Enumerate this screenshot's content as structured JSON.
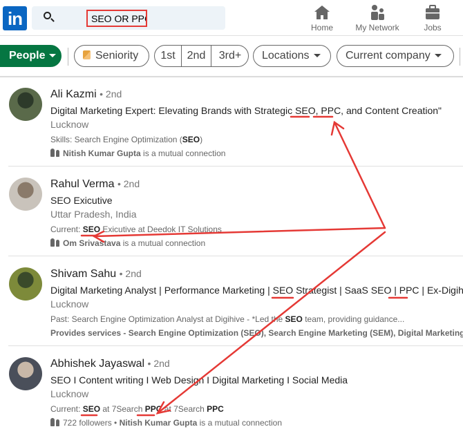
{
  "header": {
    "logo": "in",
    "search_value": "SEO OR PPC",
    "nav": [
      {
        "label": "Home",
        "icon": "home-icon"
      },
      {
        "label": "My Network",
        "icon": "people-icon"
      },
      {
        "label": "Jobs",
        "icon": "briefcase-icon"
      }
    ]
  },
  "filters": {
    "people": "People",
    "seniority": "Seniority",
    "first": "1st",
    "second": "2nd",
    "third": "3rd+",
    "locations": "Locations",
    "current_company": "Current company"
  },
  "results": [
    {
      "name": "Ali Kazmi",
      "degree": "• 2nd",
      "headline": "Digital Marketing Expert: Elevating Brands with Strategic SEO, PPC, and Content Creation\"",
      "location": "Lucknow",
      "snippet": [
        {
          "t": "Skills: Search Engine Optimization ("
        },
        {
          "t": "SEO",
          "b": true
        },
        {
          "t": ")"
        }
      ],
      "mutual": [
        {
          "t": "Nitish Kumar Gupta",
          "b": true
        },
        {
          "t": " is a mutual connection"
        }
      ]
    },
    {
      "name": "Rahul Verma",
      "degree": "• 2nd",
      "headline": "SEO Exicutive",
      "location": "Uttar Pradesh, India",
      "snippet": [
        {
          "t": "Current: "
        },
        {
          "t": "SEO",
          "b": true
        },
        {
          "t": " Exicutive at Deedok IT Solutions"
        }
      ],
      "mutual": [
        {
          "t": "Om Srivastava",
          "b": true
        },
        {
          "t": " is a mutual connection"
        }
      ]
    },
    {
      "name": "Shivam Sahu",
      "degree": "• 2nd",
      "headline": "Digital Marketing Analyst | Performance Marketing | SEO Strategist | SaaS SEO | PPC | Ex-Digihiv...",
      "location": "Lucknow",
      "snippet": [
        {
          "t": "Past: Search Engine Optimization Analyst at Digihive - *Led the "
        },
        {
          "t": "SEO",
          "b": true
        },
        {
          "t": " team, providing guidance..."
        }
      ],
      "mutual": [
        {
          "t": "Provides services - Search Engine Optimization (SEO), Search Engine Marketing (SEM), Digital Marketing",
          "b": true
        }
      ],
      "no_icon": true
    },
    {
      "name": "Abhishek Jayaswal",
      "degree": "• 2nd",
      "headline": "SEO I Content writing I Web Design I Digital Marketing I Social Media",
      "location": "Lucknow",
      "snippet": [
        {
          "t": "Current: "
        },
        {
          "t": "SEO",
          "b": true
        },
        {
          "t": " at 7Search "
        },
        {
          "t": "PPC",
          "b": true
        },
        {
          "t": " at 7Search "
        },
        {
          "t": "PPC",
          "b": true
        }
      ],
      "mutual": [
        {
          "t": "722 followers • "
        },
        {
          "t": "Nitish Kumar Gupta",
          "b": true
        },
        {
          "t": " is a mutual connection"
        }
      ]
    }
  ],
  "colors": {
    "brand": "#0a66c2",
    "people_filter": "#057642",
    "annotation": "#e53935"
  }
}
